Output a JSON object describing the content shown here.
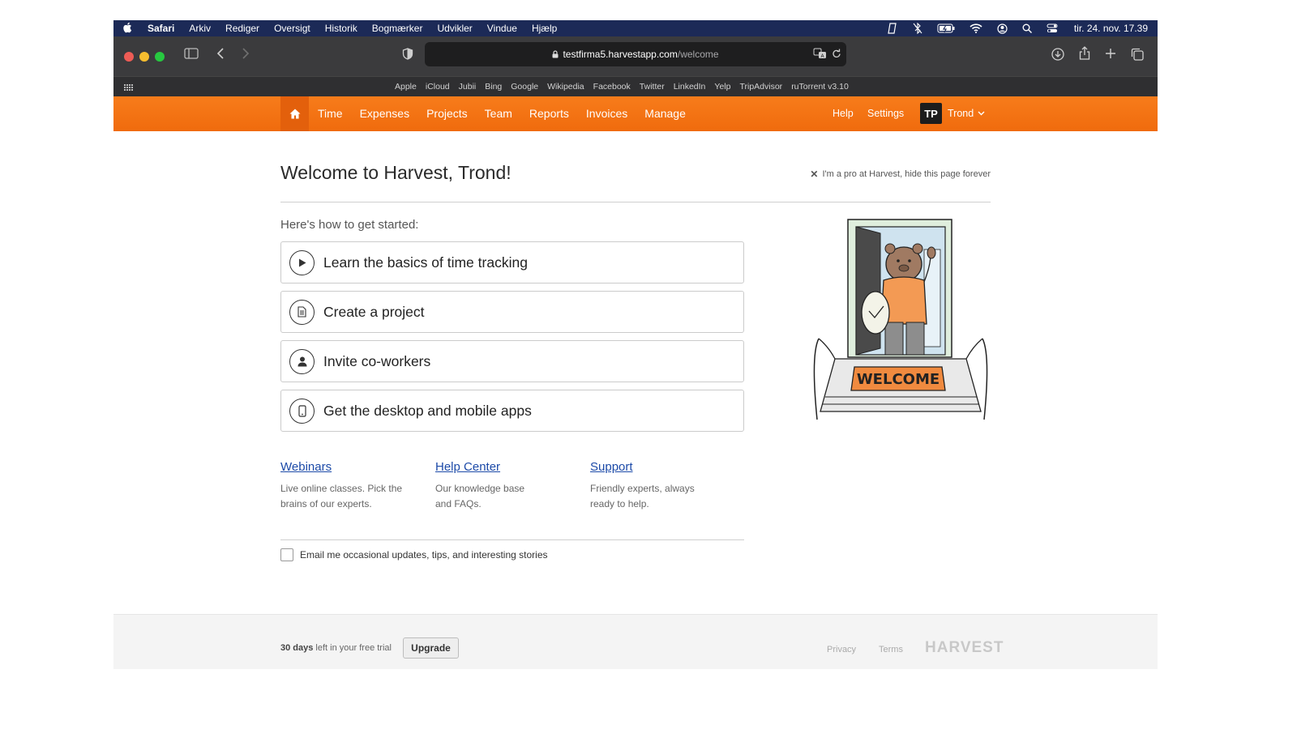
{
  "menubar": {
    "app": "Safari",
    "items": [
      "Arkiv",
      "Rediger",
      "Oversigt",
      "Historik",
      "Bogmærker",
      "Udvikler",
      "Vindue",
      "Hjælp"
    ],
    "clock": "tir. 24. nov. 17.39"
  },
  "browser": {
    "url_host": "testfirma5.harvestapp.com",
    "url_path": "/welcome",
    "favorites": [
      "Apple",
      "iCloud",
      "Jubii",
      "Bing",
      "Google",
      "Wikipedia",
      "Facebook",
      "Twitter",
      "LinkedIn",
      "Yelp",
      "TripAdvisor",
      "ruTorrent v3.10"
    ]
  },
  "nav": {
    "items": [
      "Time",
      "Expenses",
      "Projects",
      "Team",
      "Reports",
      "Invoices",
      "Manage"
    ],
    "help": "Help",
    "settings": "Settings",
    "avatar": "TP",
    "user": "Trond"
  },
  "page": {
    "title": "Welcome to Harvest, Trond!",
    "hide": "I'm a pro at Harvest, hide this page forever",
    "started": "Here's how to get started:",
    "steps": [
      {
        "label": "Learn the basics of time tracking",
        "icon": "play-icon"
      },
      {
        "label": "Create a project",
        "icon": "document-icon"
      },
      {
        "label": "Invite co-workers",
        "icon": "person-icon"
      },
      {
        "label": "Get the desktop and mobile apps",
        "icon": "phone-icon"
      }
    ],
    "links": [
      {
        "title": "Webinars",
        "desc": "Live online classes. Pick the brains of our experts."
      },
      {
        "title": "Help Center",
        "desc": "Our knowledge base and FAQs."
      },
      {
        "title": "Support",
        "desc": "Friendly experts, always ready to help."
      }
    ],
    "email_label": "Email me occasional updates, tips, and interesting stories",
    "doormat_text": "WELCOME"
  },
  "footer": {
    "trial_days": "30 days",
    "trial_rest": " left in your free trial",
    "upgrade": "Upgrade",
    "privacy": "Privacy",
    "terms": "Terms",
    "brand": "HARVEST"
  },
  "colors": {
    "menubar": "#1c2a57",
    "toolbar": "#3b3b3d",
    "harvest_orange": "#f77c1b",
    "link": "#1c4aa8"
  }
}
